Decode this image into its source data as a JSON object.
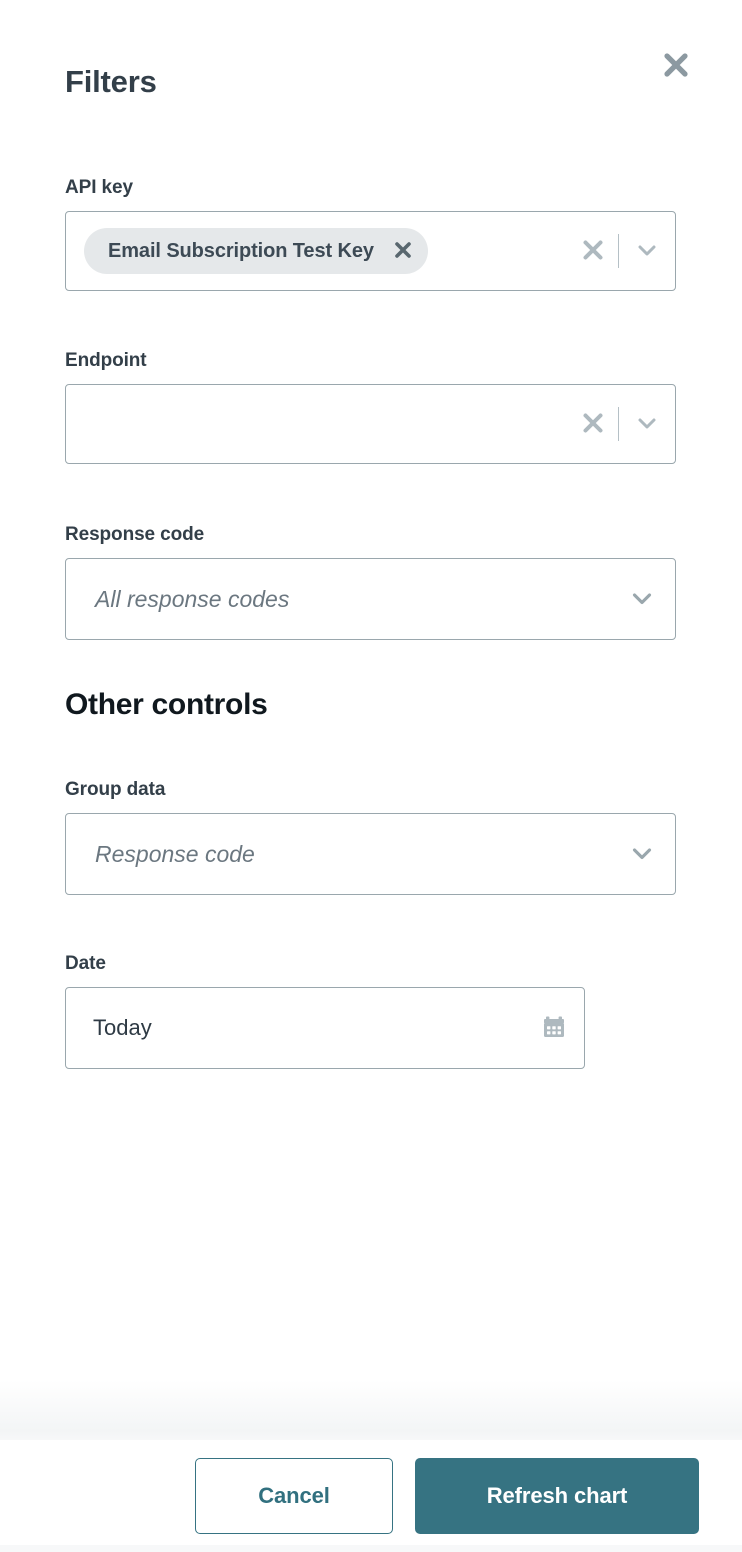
{
  "header": {
    "title": "Filters",
    "close_icon": "close-icon"
  },
  "filters": {
    "api_key": {
      "label": "API key",
      "chips": [
        {
          "label": "Email Subscription Test Key",
          "remove_icon": "close-icon"
        }
      ],
      "clear_icon": "clear-icon",
      "chevron_icon": "chevron-down-icon"
    },
    "endpoint": {
      "label": "Endpoint",
      "value": "",
      "clear_icon": "clear-icon",
      "chevron_icon": "chevron-down-icon"
    },
    "response_code": {
      "label": "Response code",
      "placeholder": "All response codes",
      "chevron_icon": "chevron-down-icon"
    }
  },
  "other_controls": {
    "heading": "Other controls",
    "group_data": {
      "label": "Group data",
      "placeholder": "Response code",
      "chevron_icon": "chevron-down-icon"
    },
    "date": {
      "label": "Date",
      "value": "Today",
      "calendar_icon": "calendar-icon"
    }
  },
  "footer": {
    "cancel_label": "Cancel",
    "submit_label": "Refresh chart"
  },
  "colors": {
    "accent": "#367382",
    "accent_text": "#31707f",
    "title": "#333f49",
    "heading": "#10181e",
    "border": "#9aa7ad",
    "placeholder": "#6b7780",
    "chip_bg": "#e5e8ea",
    "icon_gray": "#9aa7ad"
  }
}
